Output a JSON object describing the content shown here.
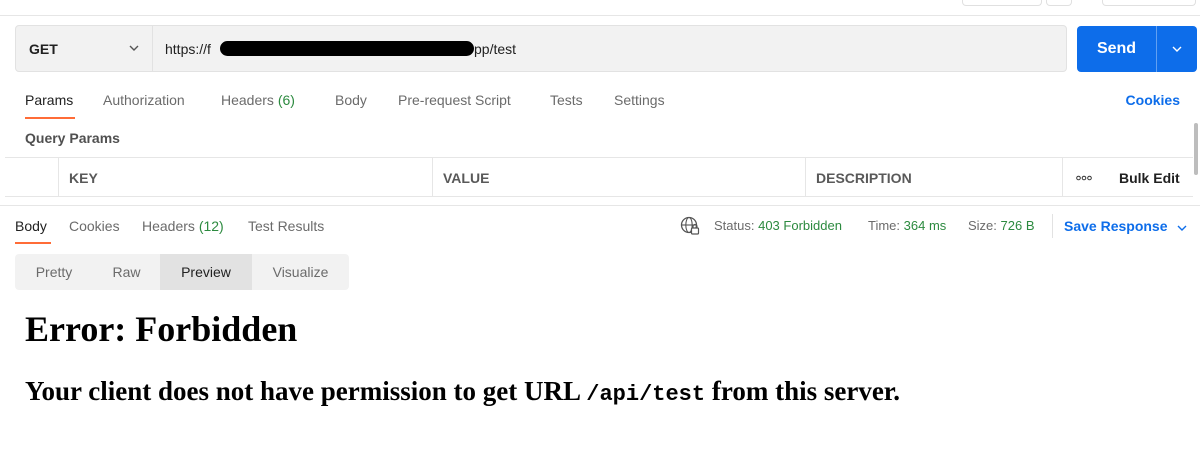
{
  "request": {
    "method": "GET",
    "url_prefix": "https://f",
    "url_suffix": "pp/test",
    "send_label": "Send"
  },
  "request_tabs": [
    {
      "label": "Params",
      "count": ""
    },
    {
      "label": "Authorization",
      "count": ""
    },
    {
      "label": "Headers",
      "count": "(6)"
    },
    {
      "label": "Body",
      "count": ""
    },
    {
      "label": "Pre-request Script",
      "count": ""
    },
    {
      "label": "Tests",
      "count": ""
    },
    {
      "label": "Settings",
      "count": ""
    }
  ],
  "cookies_link": "Cookies",
  "query_params": {
    "title": "Query Params",
    "columns": [
      "KEY",
      "VALUE",
      "DESCRIPTION"
    ],
    "more_label": "ooo",
    "bulk_edit": "Bulk Edit"
  },
  "response_tabs": [
    {
      "label": "Body",
      "count": ""
    },
    {
      "label": "Cookies",
      "count": ""
    },
    {
      "label": "Headers",
      "count": "(12)"
    },
    {
      "label": "Test Results",
      "count": ""
    }
  ],
  "response_meta": {
    "status_label": "Status:",
    "status_value": "403 Forbidden",
    "time_label": "Time:",
    "time_value": "364 ms",
    "size_label": "Size:",
    "size_value": "726 B",
    "save_response": "Save Response"
  },
  "view_modes": [
    "Pretty",
    "Raw",
    "Preview",
    "Visualize"
  ],
  "preview": {
    "heading": "Error: Forbidden",
    "message_before": "Your client does not have permission to get URL ",
    "message_code": "/api/test",
    "message_after": " from this server."
  },
  "colors": {
    "accent_orange": "#ff6c37",
    "send_blue": "#0d6dea",
    "status_green": "#2c8a3f"
  },
  "icons": [
    "chevron-down-icon",
    "globe-lock-icon"
  ]
}
